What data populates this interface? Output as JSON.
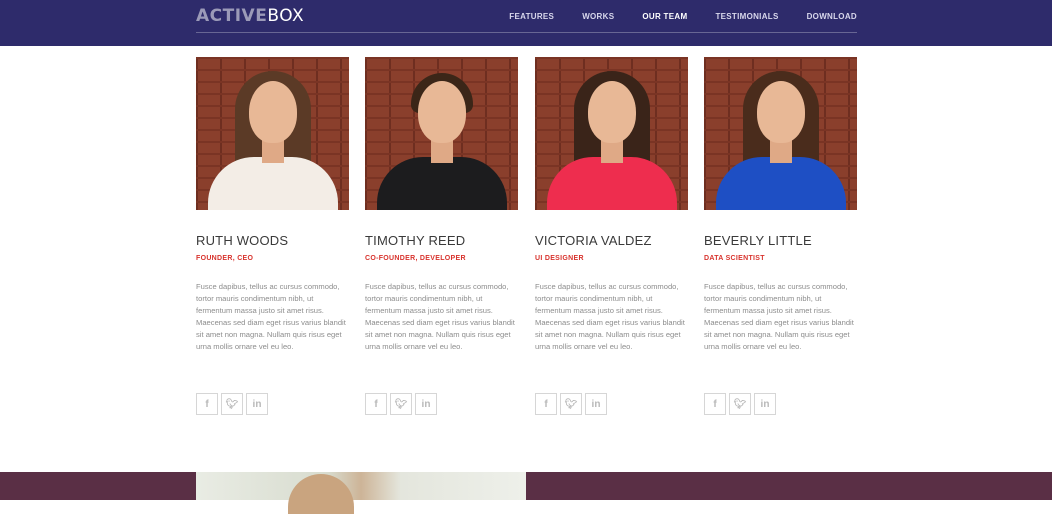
{
  "header": {
    "logo_bold": "ACTIVE",
    "logo_light": "BOX",
    "nav": [
      {
        "label": "FEATURES",
        "active": false
      },
      {
        "label": "WORKS",
        "active": false
      },
      {
        "label": "OUR TEAM",
        "active": true
      },
      {
        "label": "TESTIMONIALS",
        "active": false
      },
      {
        "label": "DOWNLOAD",
        "active": false
      }
    ]
  },
  "team": [
    {
      "name": "RUTH WOODS",
      "role": "FOUNDER, CEO",
      "bio": "Fusce dapibus, tellus ac cursus commodo, tortor mauris condimentum nibh, ut fermentum massa justo sit amet risus. Maecenas sed diam eget risus varius blandit sit amet non magna. Nullam quis risus eget urna mollis ornare vel eu leo.",
      "hair": "#5b3a26",
      "shirt": "#f3ede6"
    },
    {
      "name": "TIMOTHY REED",
      "role": "CO-FOUNDER, DEVELOPER",
      "bio": "Fusce dapibus, tellus ac cursus commodo, tortor mauris condimentum nibh, ut fermentum massa justo sit amet risus. Maecenas sed diam eget risus varius blandit sit amet non magna. Nullam quis risus eget urna mollis ornare vel eu leo.",
      "hair": "#3b2618",
      "shirt": "#1c1c1e"
    },
    {
      "name": "VICTORIA VALDEZ",
      "role": "UI DESIGNER",
      "bio": "Fusce dapibus, tellus ac cursus commodo, tortor mauris condimentum nibh, ut fermentum massa justo sit amet risus. Maecenas sed diam eget risus varius blandit sit amet non magna. Nullam quis risus eget urna mollis ornare vel eu leo.",
      "hair": "#3a2419",
      "shirt": "#ee2d4e"
    },
    {
      "name": "BEVERLY LITTLE",
      "role": "DATA SCIENTIST",
      "bio": "Fusce dapibus, tellus ac cursus commodo, tortor mauris condimentum nibh, ut fermentum massa justo sit amet risus. Maecenas sed diam eget risus varius blandit sit amet non magna. Nullam quis risus eget urna mollis ornare vel eu leo.",
      "hair": "#4a2c1c",
      "shirt": "#1e4fc4"
    }
  ],
  "social_icons": [
    {
      "name": "facebook-icon",
      "glyph": "f"
    },
    {
      "name": "twitter-icon",
      "glyph": "t"
    },
    {
      "name": "linkedin-icon",
      "glyph": "in"
    }
  ],
  "colors": {
    "nav_bg": "#2e2b6b",
    "accent": "#d8332d",
    "footer_bg": "#5a2f45"
  }
}
